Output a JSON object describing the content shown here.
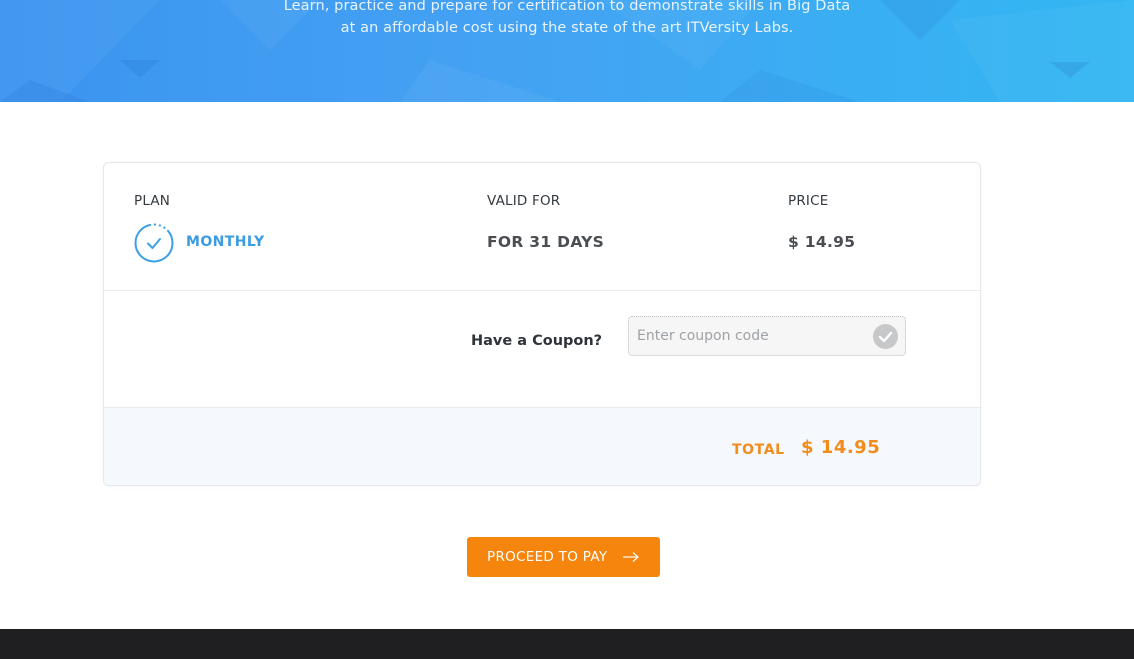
{
  "hero": {
    "line1": "Learn, practice and prepare for certification to demonstrate skills in Big Data",
    "line2": "at an affordable cost using the state of the art ITVersity Labs."
  },
  "plan_table": {
    "headers": {
      "plan": "PLAN",
      "valid_for": "VALID FOR",
      "price": "PRICE"
    },
    "selected_plan": {
      "name": "MONTHLY",
      "valid_for": "FOR 31 DAYS",
      "price": "$ 14.95"
    }
  },
  "coupon": {
    "label": "Have a Coupon?",
    "value": "",
    "placeholder": "Enter coupon code"
  },
  "total": {
    "label": "TOTAL",
    "amount": "$ 14.95"
  },
  "actions": {
    "proceed_label": "PROCEED TO PAY"
  },
  "colors": {
    "accent_orange": "#f5850c",
    "plan_blue": "#3d9be0",
    "hero_blue": "#3b94ef"
  },
  "icons": [
    "check-circle-icon",
    "check-icon",
    "arrow-right-icon"
  ]
}
